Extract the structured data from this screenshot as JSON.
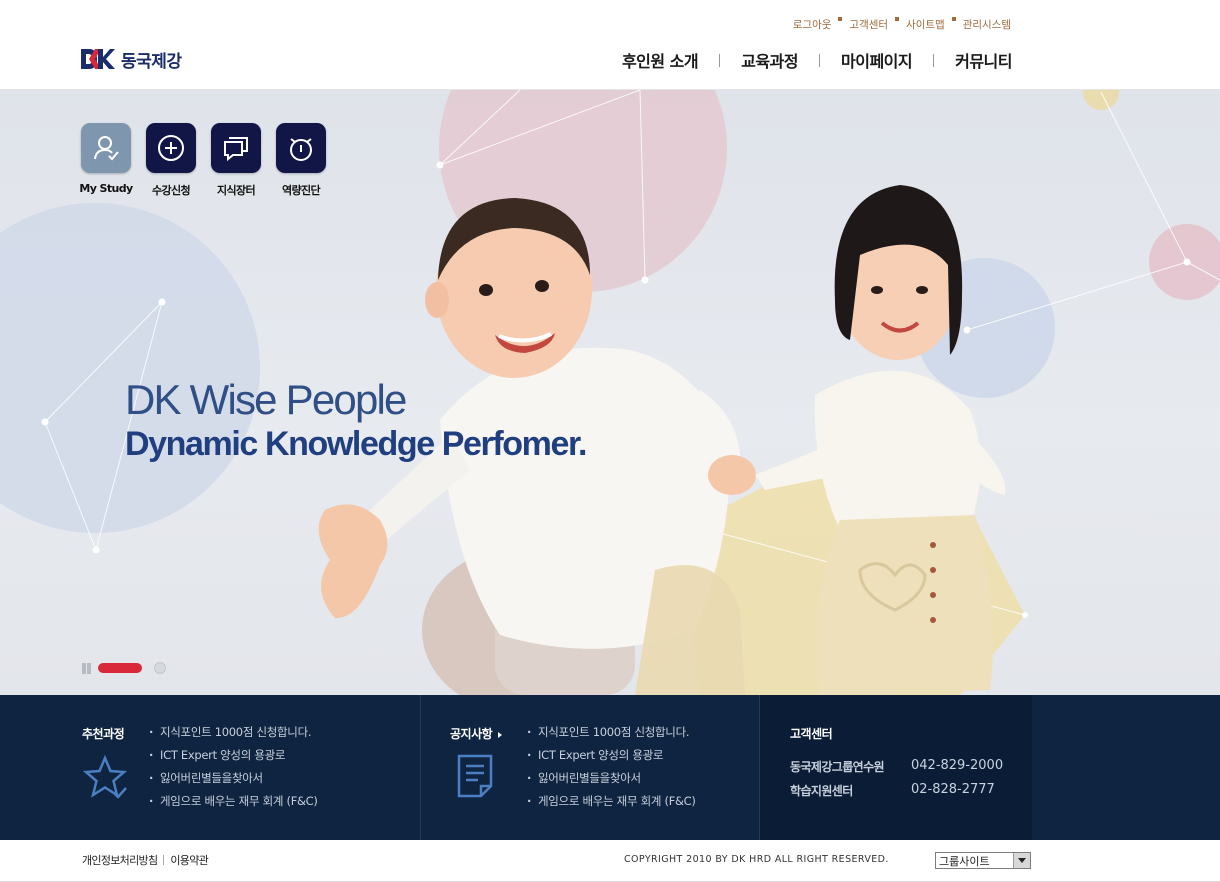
{
  "header": {
    "brand": {
      "logo_text": "동국제강"
    },
    "util_nav": [
      {
        "label": "로그아웃"
      },
      {
        "label": "고객센터"
      },
      {
        "label": "사이트맵"
      },
      {
        "label": "관리시스템"
      }
    ],
    "gnb": [
      {
        "label": "후인원 소개"
      },
      {
        "label": "교육과정"
      },
      {
        "label": "마이페이지"
      },
      {
        "label": "커뮤니티"
      }
    ]
  },
  "visual": {
    "quick_menu": [
      {
        "label": "My Study",
        "icon": "person-check-icon"
      },
      {
        "label": "수강신청",
        "icon": "plus-circle-icon"
      },
      {
        "label": "지식장터",
        "icon": "speech-bubble-icon"
      },
      {
        "label": "역량진단",
        "icon": "alarm-clock-icon"
      }
    ],
    "slogan": {
      "line1": "DK Wise People",
      "line2": "Dynamic Knowledge Perfomer."
    },
    "pager": {
      "total": 2,
      "current": 1
    }
  },
  "info": {
    "recommended": {
      "title": "추천과정",
      "items": [
        "지식포인트 1000점 신청합니다.",
        "ICT Expert 양성의 용광로",
        "잃어버린별들을찾아서",
        "게임으로 배우는 재무 회계 (F&C)"
      ]
    },
    "notice": {
      "title": "공지사항",
      "items": [
        "지식포인트 1000점 신청합니다.",
        "ICT Expert 양성의 용광로",
        "잃어버린별들을찾아서",
        "게임으로 배우는 재무 회계 (F&C)"
      ]
    },
    "customer_center": {
      "title": "고객센터",
      "contacts": [
        {
          "name": "동국제강그룹연수원",
          "phone": "042-829-2000"
        },
        {
          "name": "학습지원센터",
          "phone": "02-828-2777"
        }
      ]
    }
  },
  "footer": {
    "links": [
      "개인정보처리방침",
      "이용약관"
    ],
    "copyright": "COPYRIGHT 2010 BY DK HRD ALL RIGHT RESERVED.",
    "group_site": "그룹사이트"
  },
  "colors": {
    "brand_navy": "#1b2c6b",
    "brand_red": "#d8283a",
    "band_bg": "#0f2440",
    "util_text": "#a06a3c"
  }
}
